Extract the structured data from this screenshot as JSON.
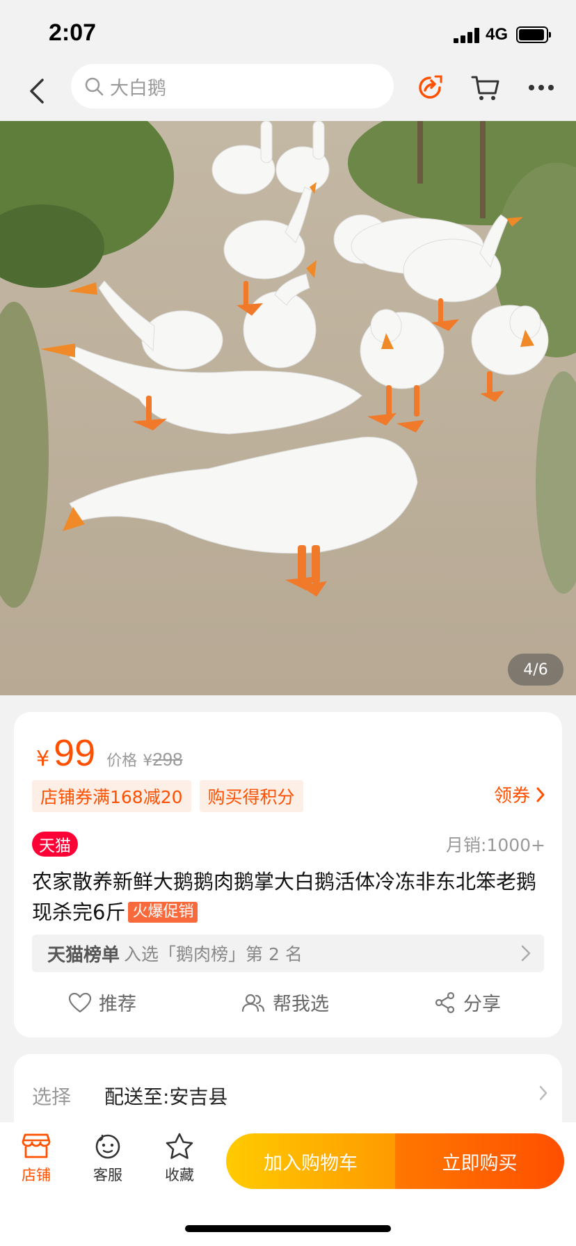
{
  "status_bar": {
    "time": "2:07",
    "network": "4G"
  },
  "nav": {
    "search_text": "大白鹅"
  },
  "gallery": {
    "counter": "4/6"
  },
  "product": {
    "currency": "¥",
    "price": "99",
    "original_label": "价格",
    "original_currency": "¥",
    "original_price": "298",
    "tags": [
      "店铺券满168减20",
      "购买得积分"
    ],
    "coupon_label": "领券",
    "badge": "天猫",
    "monthly_sales": "月销:1000+",
    "title": "农家散养新鲜大鹅鹅肉鹅掌大白鹅活体冷冻非东北笨老鹅现杀完6斤",
    "hot_tag": "火爆促销",
    "rank_name": "天猫榜单",
    "rank_desc": "入选「鹅肉榜」第 2 名",
    "actions": {
      "recommend": "推荐",
      "help_choose": "帮我选",
      "share": "分享"
    }
  },
  "options": {
    "label": "选择",
    "value": "配送至:安吉县"
  },
  "bottom_bar": {
    "store": "店铺",
    "service": "客服",
    "favorite": "收藏",
    "add_to_cart": "加入购物车",
    "buy_now": "立即购买"
  },
  "colors": {
    "accent": "#ff5000",
    "tmall_red": "#ff0036",
    "cart_yellow": "#ffb400",
    "buy_orange": "#ff5a00"
  }
}
